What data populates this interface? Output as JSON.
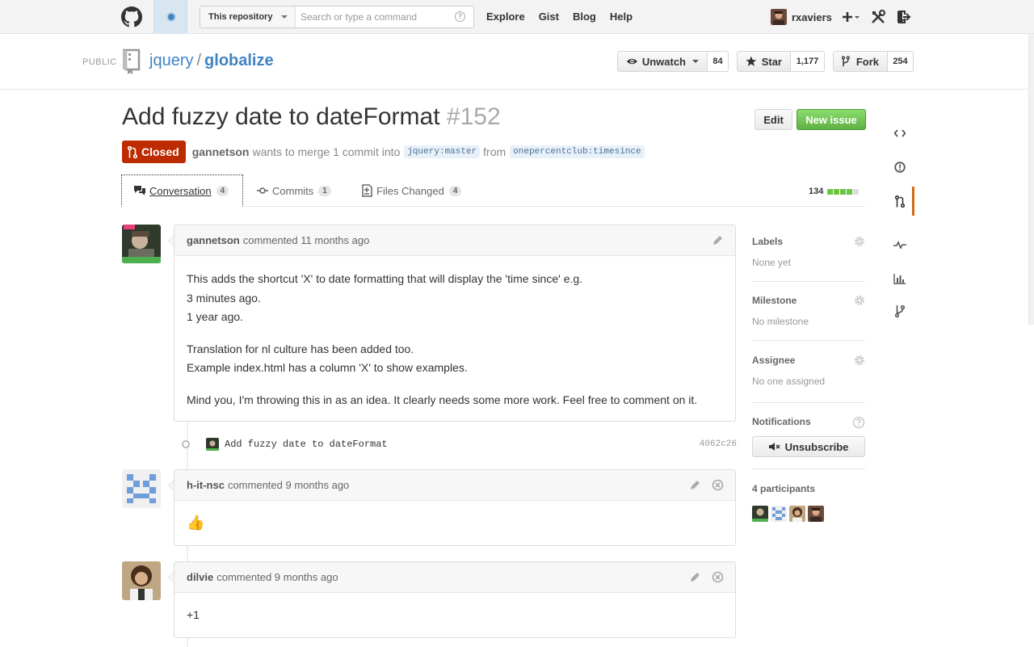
{
  "header": {
    "search_scope": "This repository",
    "search_placeholder": "Search or type a command",
    "search_help": "?",
    "nav": [
      "Explore",
      "Gist",
      "Blog",
      "Help"
    ],
    "username": "rxaviers",
    "new_menu": "+"
  },
  "repo": {
    "visibility": "PUBLIC",
    "owner": "jquery",
    "separator": "/",
    "name": "globalize",
    "watch_label": "Unwatch",
    "watch_count": "84",
    "star_label": "Star",
    "star_count": "1,177",
    "fork_label": "Fork",
    "fork_count": "254"
  },
  "pull": {
    "title": "Add fuzzy date to dateFormat",
    "number": "#152",
    "state": "Closed",
    "author": "gannetson",
    "merge_text": "wants to merge 1 commit into",
    "base_user": "jquery",
    "base_branch": "master",
    "from_text": "from",
    "head_user": "onepercentclub",
    "head_branch": "timesince",
    "colon": ":",
    "edit_label": "Edit",
    "new_issue_label": "New issue"
  },
  "tabs": [
    {
      "label": "Conversation",
      "count": "4"
    },
    {
      "label": "Commits",
      "count": "1"
    },
    {
      "label": "Files Changed",
      "count": "4"
    }
  ],
  "diffstat": {
    "total": "134",
    "colors": [
      "#6cc644",
      "#6cc644",
      "#6cc644",
      "#6cc644",
      "#ddd"
    ]
  },
  "comments": [
    {
      "author": "gannetson",
      "action": "commented",
      "time": "11 months ago",
      "paragraphs": [
        [
          "This adds the shortcut 'X' to date formatting that will display the 'time since' e.g.",
          "3 minutes ago.",
          "1 year ago."
        ],
        [
          "Translation for nl culture has been added too.",
          "Example index.html has a column 'X' to show examples."
        ],
        [
          "Mind you, I'm throwing this in as an idea. It clearly needs some more work. Feel free to comment on it."
        ]
      ]
    },
    {
      "author": "h-it-nsc",
      "action": "commented",
      "time": "9 months ago",
      "body": "👍"
    },
    {
      "author": "dilvie",
      "action": "commented",
      "time": "9 months ago",
      "body": "+1"
    }
  ],
  "commit": {
    "message": "Add fuzzy date to dateFormat",
    "sha": "4062c26"
  },
  "sidebar": {
    "labels_title": "Labels",
    "labels_value": "None yet",
    "milestone_title": "Milestone",
    "milestone_value": "No milestone",
    "assignee_title": "Assignee",
    "assignee_value": "No one assigned",
    "notifications_title": "Notifications",
    "unsubscribe_label": "Unsubscribe",
    "participants_title": "4 participants"
  },
  "colors": {
    "link": "#4183c4",
    "closed": "#bd2c00",
    "new_issue": "#60b044",
    "active_tab_bar": "#d26911"
  }
}
